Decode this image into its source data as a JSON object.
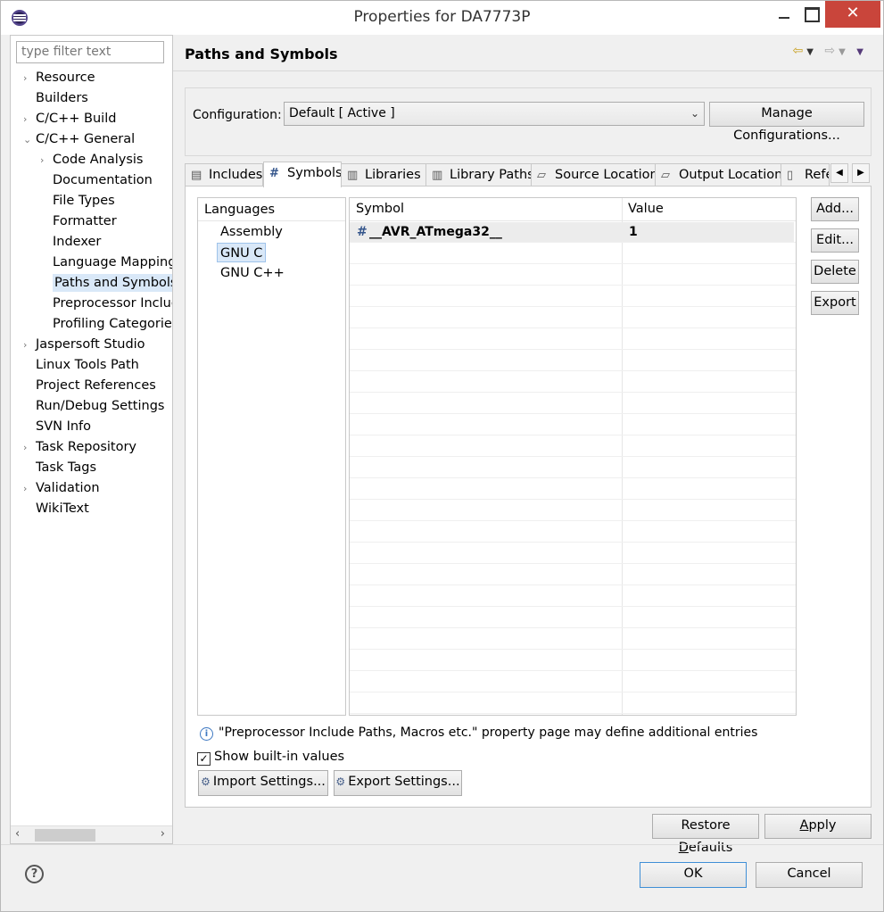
{
  "window": {
    "title": "Properties for DA7773P",
    "close_glyph": "✕"
  },
  "left_pane": {
    "filter_placeholder": "type filter text",
    "tree": [
      {
        "label": "Resource",
        "expander": "›"
      },
      {
        "label": "Builders",
        "expander": ""
      },
      {
        "label": "C/C++ Build",
        "expander": "›"
      },
      {
        "label": "C/C++ General",
        "expander": "⌄"
      },
      {
        "label": "Code Analysis",
        "expander": "›"
      },
      {
        "label": "Documentation",
        "expander": ""
      },
      {
        "label": "File Types",
        "expander": ""
      },
      {
        "label": "Formatter",
        "expander": ""
      },
      {
        "label": "Indexer",
        "expander": ""
      },
      {
        "label": "Language Mapping",
        "expander": ""
      },
      {
        "label": "Paths and Symbols",
        "expander": "",
        "selected": true
      },
      {
        "label": "Preprocessor Include",
        "expander": ""
      },
      {
        "label": "Profiling Categories",
        "expander": ""
      },
      {
        "label": "Jaspersoft Studio",
        "expander": "›"
      },
      {
        "label": "Linux Tools Path",
        "expander": ""
      },
      {
        "label": "Project References",
        "expander": ""
      },
      {
        "label": "Run/Debug Settings",
        "expander": ""
      },
      {
        "label": "SVN Info",
        "expander": ""
      },
      {
        "label": "Task Repository",
        "expander": "›"
      },
      {
        "label": "Task Tags",
        "expander": ""
      },
      {
        "label": "Validation",
        "expander": "›"
      },
      {
        "label": "WikiText",
        "expander": ""
      }
    ]
  },
  "page": {
    "title": "Paths and Symbols",
    "configuration_label": "Configuration:",
    "configuration_value": "Default  [ Active ]",
    "manage_button": "Manage Configurations...",
    "tabs": [
      {
        "label": "Includes",
        "icon": "includes-icon",
        "glyph": "▤"
      },
      {
        "label": "Symbols",
        "icon": "hash-icon",
        "glyph": "#",
        "active": true
      },
      {
        "label": "Libraries",
        "icon": "library-icon",
        "glyph": "▥"
      },
      {
        "label": "Library Paths",
        "icon": "library-paths-icon",
        "glyph": "▥"
      },
      {
        "label": "Source Location",
        "icon": "folder-icon",
        "glyph": "▱"
      },
      {
        "label": "Output Location",
        "icon": "folder-icon",
        "glyph": "▱"
      },
      {
        "label": "References",
        "icon": "references-icon",
        "glyph": "▯"
      }
    ],
    "languages_header": "Languages",
    "languages": [
      {
        "label": "Assembly"
      },
      {
        "label": "GNU C",
        "selected": true
      },
      {
        "label": "GNU C++"
      }
    ],
    "table": {
      "col_symbol": "Symbol",
      "col_value": "Value",
      "rows": [
        {
          "symbol": "__AVR_ATmega32__",
          "value": "1"
        }
      ]
    },
    "side_buttons": {
      "add": "Add...",
      "edit": "Edit...",
      "delete": "Delete",
      "export": "Export"
    },
    "info_text": "\"Preprocessor Include Paths, Macros etc.\" property page may define additional entries",
    "show_builtin_label": "Show built-in values",
    "show_builtin_checked": true,
    "import_button": "Import Settings...",
    "export_button": "Export Settings...",
    "restore_defaults": {
      "pre": "Restore ",
      "u": "D",
      "post": "efaults"
    },
    "apply": {
      "u": "A",
      "post": "pply"
    }
  },
  "footer": {
    "ok": "OK",
    "cancel": "Cancel"
  }
}
